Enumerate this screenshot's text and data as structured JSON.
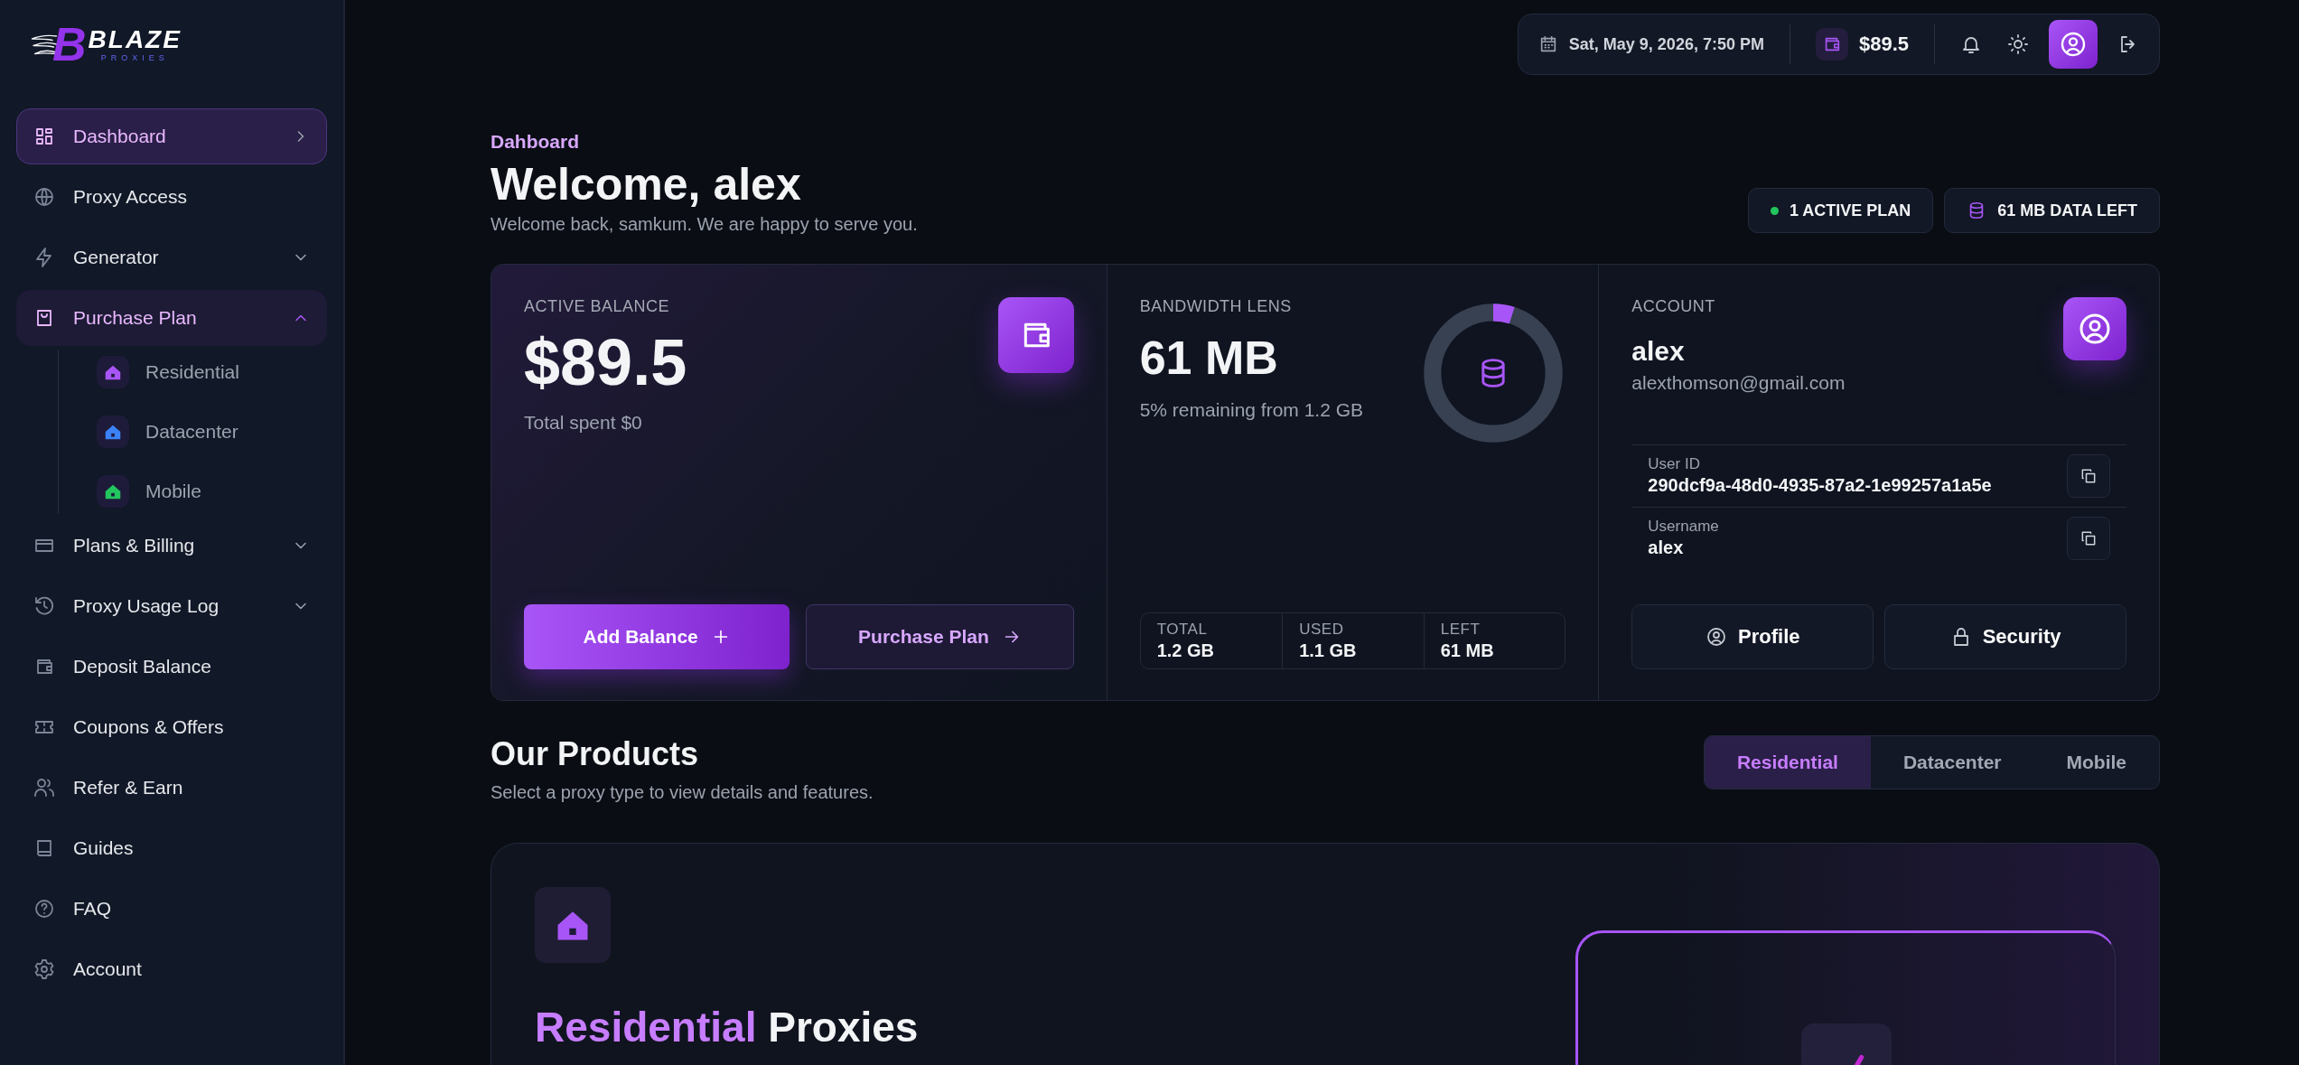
{
  "logo": {
    "mark": "B",
    "name": "BLAZE",
    "tagline": "PROXIES"
  },
  "sidebar": {
    "items": [
      {
        "label": "Dashboard",
        "selected": true,
        "expandable": false,
        "expanded": false
      },
      {
        "label": "Proxy Access",
        "selected": false,
        "expandable": false,
        "expanded": false
      },
      {
        "label": "Generator",
        "selected": false,
        "expandable": true,
        "expanded": false
      },
      {
        "label": "Purchase Plan",
        "selected": false,
        "expandable": true,
        "expanded": true,
        "children": [
          {
            "label": "Residential",
            "color": "#a855f7"
          },
          {
            "label": "Datacenter",
            "color": "#3b82f6"
          },
          {
            "label": "Mobile",
            "color": "#22c55e"
          }
        ]
      },
      {
        "label": "Plans & Billing",
        "selected": false,
        "expandable": true,
        "expanded": false
      },
      {
        "label": "Proxy Usage Log",
        "selected": false,
        "expandable": true,
        "expanded": false
      },
      {
        "label": "Deposit Balance",
        "selected": false,
        "expandable": false,
        "expanded": false
      },
      {
        "label": "Coupons & Offers",
        "selected": false,
        "expandable": false,
        "expanded": false
      },
      {
        "label": "Refer & Earn",
        "selected": false,
        "expandable": false,
        "expanded": false
      },
      {
        "label": "Guides",
        "selected": false,
        "expandable": false,
        "expanded": false
      },
      {
        "label": "FAQ",
        "selected": false,
        "expandable": false,
        "expanded": false
      },
      {
        "label": "Account",
        "selected": false,
        "expandable": false,
        "expanded": false
      }
    ]
  },
  "topbar": {
    "datetime": "Sat, May 9, 2026, 7:50 PM",
    "balance": "$89.5"
  },
  "header": {
    "breadcrumb": "Dahboard",
    "title": "Welcome, alex",
    "subtitle": "Welcome back, samkum. We are happy to serve you.",
    "badges": [
      {
        "kind": "status",
        "label": "1 ACTIVE PLAN",
        "color": "#22c55e"
      },
      {
        "kind": "data",
        "label": "61 MB DATA LEFT"
      }
    ]
  },
  "balance_card": {
    "label": "ACTIVE BALANCE",
    "amount": "$89.5",
    "spent": "Total spent $0",
    "primary_button": "Add Balance",
    "secondary_button": "Purchase Plan"
  },
  "bandwidth_card": {
    "label": "BANDWIDTH LENS",
    "amount": "61 MB",
    "note": "5% remaining from 1.2 GB",
    "level": 0.05,
    "stats": [
      {
        "label": "TOTAL",
        "value": "1.2 GB"
      },
      {
        "label": "USED",
        "value": "1.1 GB"
      },
      {
        "label": "LEFT",
        "value": "61 MB"
      }
    ]
  },
  "account_card": {
    "label": "ACCOUNT",
    "name": "alex",
    "email": "alexthomson@gmail.com",
    "fields": [
      {
        "label": "User ID",
        "value": "290dcf9a-48d0-4935-87a2-1e99257a1a5e"
      },
      {
        "label": "Username",
        "value": "alex"
      }
    ],
    "buttons": [
      {
        "kind": "profile",
        "label": "Profile"
      },
      {
        "kind": "security",
        "label": "Security"
      }
    ]
  },
  "products": {
    "title": "Our Products",
    "subtitle": "Select a proxy type to view details and features.",
    "tabs": [
      {
        "label": "Residential",
        "selected": true
      },
      {
        "label": "Datacenter",
        "selected": false
      },
      {
        "label": "Mobile",
        "selected": false
      }
    ],
    "card": {
      "title_highlight": "Residential",
      "title_rest": "Proxies"
    }
  }
}
